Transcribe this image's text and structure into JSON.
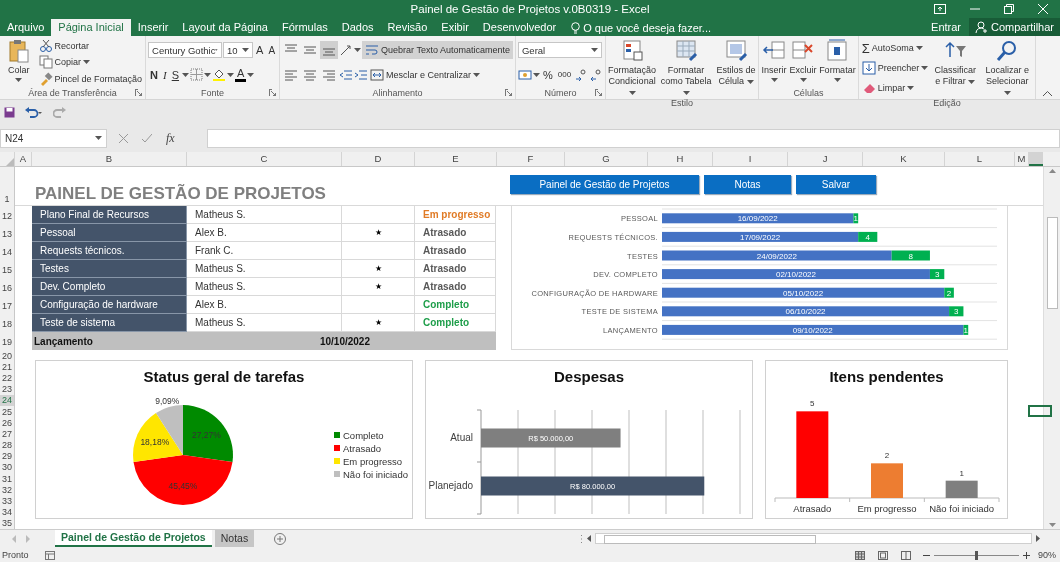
{
  "window": {
    "title": "Painel de Gestão de Projetos v.0B0319 - Excel"
  },
  "ribbon_tabs": [
    {
      "label": "Arquivo",
      "selected": false
    },
    {
      "label": "Página Inicial",
      "selected": true
    },
    {
      "label": "Inserir",
      "selected": false
    },
    {
      "label": "Layout da Página",
      "selected": false
    },
    {
      "label": "Fórmulas",
      "selected": false
    },
    {
      "label": "Dados",
      "selected": false
    },
    {
      "label": "Revisão",
      "selected": false
    },
    {
      "label": "Exibir",
      "selected": false
    },
    {
      "label": "Desenvolvedor",
      "selected": false
    }
  ],
  "tell_me": {
    "placeholder": "O que você deseja fazer..."
  },
  "account": {
    "sign_in": "Entrar",
    "share": "Compartilhar"
  },
  "ribbon": {
    "groups": [
      {
        "kind": "clipboard",
        "label": "Área de Transferência",
        "paste": "Colar",
        "cut": "Recortar",
        "copy": "Copiar",
        "painter": "Pincel de Formatação"
      },
      {
        "kind": "font",
        "label": "Fonte",
        "font": "Century Gothic",
        "size": "10",
        "grow": "A",
        "shrink": "A",
        "bold": "N",
        "italic": "I",
        "underline": "S",
        "color_letter": "A"
      },
      {
        "kind": "alignment",
        "label": "Alinhamento",
        "wrap": {
          "label": "Quebrar Texto Automaticamente",
          "on": true
        },
        "merge": "Mesclar e Centralizar",
        "bottom_align_on": true
      },
      {
        "kind": "number",
        "label": "Número",
        "format": "Geral",
        "percent": "%",
        "thousands": "000"
      },
      {
        "kind": "styles",
        "label": "Estilo",
        "buttons": [
          "Formatação Condicional",
          "Formatar como Tabela",
          "Estilos de Célula"
        ]
      },
      {
        "kind": "cells",
        "label": "Células",
        "buttons": [
          "Inserir",
          "Excluir",
          "Formatar"
        ]
      },
      {
        "kind": "editing",
        "label": "Edição",
        "sigma": "Σ",
        "autosum": "AutoSoma",
        "fill": "Preencher",
        "clear": "Limpar",
        "buttons": [
          "Classificar e Filtrar",
          "Localizar e Selecionar"
        ]
      }
    ]
  },
  "formula_bar": {
    "name_box": "N24",
    "function_label": "fx"
  },
  "columns": [
    "A",
    "B",
    "C",
    "D",
    "E",
    "F",
    "G",
    "H",
    "I",
    "J",
    "K",
    "L",
    "M"
  ],
  "row_headers": [
    {
      "label": "1",
      "selected": false
    },
    {
      "label": "12",
      "selected": false
    },
    {
      "label": "13",
      "selected": false
    },
    {
      "label": "14",
      "selected": false
    },
    {
      "label": "15",
      "selected": false
    },
    {
      "label": "16",
      "selected": false
    },
    {
      "label": "17",
      "selected": false
    },
    {
      "label": "18",
      "selected": false
    },
    {
      "label": "19",
      "selected": false
    },
    {
      "label": "20",
      "selected": false
    },
    {
      "label": "21",
      "selected": false
    },
    {
      "label": "22",
      "selected": false
    },
    {
      "label": "23",
      "selected": false
    },
    {
      "label": "24",
      "selected": true
    },
    {
      "label": "25",
      "selected": false
    },
    {
      "label": "26",
      "selected": false
    },
    {
      "label": "27",
      "selected": false
    },
    {
      "label": "28",
      "selected": false
    },
    {
      "label": "29",
      "selected": false
    },
    {
      "label": "30",
      "selected": false
    },
    {
      "label": "31",
      "selected": false
    },
    {
      "label": "32",
      "selected": false
    },
    {
      "label": "33",
      "selected": false
    },
    {
      "label": "34",
      "selected": false
    },
    {
      "label": "35",
      "selected": false
    }
  ],
  "sheet": {
    "title": "PAINEL DE GESTÃO DE PROJETOS",
    "buttons": [
      "Painel de Gestão de Projetos",
      "Notas",
      "Salvar"
    ],
    "tasks": [
      {
        "task": "Plano Final de Recursos",
        "owner": "Matheus S.",
        "status": "Em progresso",
        "color": "#e07b26"
      },
      {
        "task": "Pessoal",
        "owner": "Alex B.",
        "flag": "★",
        "status": "Atrasado",
        "color": "#595959"
      },
      {
        "task": "Requests técnicos.",
        "owner": "Frank C.",
        "status": "Atrasado",
        "color": "#595959"
      },
      {
        "task": "Testes",
        "owner": "Matheus S.",
        "flag": "★",
        "status": "Atrasado",
        "color": "#595959"
      },
      {
        "task": "Dev. Completo",
        "owner": "Matheus S.",
        "flag": "★",
        "status": "Atrasado",
        "color": "#595959"
      },
      {
        "task": "Configuração de hardware",
        "owner": "Alex B.",
        "status": "Completo",
        "color": "#1e9e4a"
      },
      {
        "task": "Teste de sistema",
        "owner": "Matheus S.",
        "flag": "★",
        "status": "Completo",
        "color": "#1e9e4a"
      }
    ],
    "launch": {
      "label": "Lançamento",
      "date": "10/10/2022"
    },
    "timeline": {
      "chart_data": {
        "type": "bar",
        "orientation": "horizontal",
        "stacked": true,
        "categories": [
          "PESSOAL",
          "REQUESTS TÉCNICOS.",
          "TESTES",
          "DEV. COMPLETO",
          "CONFIGURAÇÃO DE HARDWARE",
          "TESTE DE SISTEMA",
          "LANÇAMENTO"
        ],
        "series": [
          {
            "color": "#4472c4",
            "values": [
              40,
              41,
              48,
              56,
              59,
              60,
              63
            ],
            "value_labels": [
              "16/09/2022",
              "17/09/2022",
              "24/09/2022",
              "02/10/2022",
              "05/10/2022",
              "06/10/2022",
              "09/10/2022"
            ]
          },
          {
            "color": "#00b050",
            "values": [
              1,
              4,
              8,
              3,
              2,
              3,
              1
            ],
            "value_labels": [
              "1",
              "4",
              "8",
              "3",
              "2",
              "3",
              "1"
            ]
          }
        ]
      }
    },
    "charts": [
      {
        "chart_data": {
          "type": "pie",
          "title": "Status geral de tarefas",
          "categories": [
            "Completo",
            "Atrasado",
            "Em progresso",
            "Não foi iniciado"
          ],
          "values": [
            27.27,
            45.45,
            18.18,
            9.09
          ],
          "colors": [
            "#008a00",
            "#ff0000",
            "#ffe600",
            "#bfbfbf"
          ],
          "value_labels": [
            "27,27%",
            "45,45%",
            "18,18%",
            "9,09%"
          ]
        }
      },
      {
        "chart_data": {
          "type": "bar",
          "orientation": "horizontal",
          "stacked": true,
          "title": "Despesas",
          "categories": [
            "Atual",
            "Planejado"
          ],
          "series": [
            {
              "color": "#7f7f7f",
              "values": [
                50000,
                null
              ],
              "value_labels": [
                "R$ 50.000,00",
                null
              ]
            },
            {
              "color": "#44546a",
              "values": [
                null,
                80000
              ],
              "value_labels": [
                null,
                "R$ 80.000,00"
              ]
            }
          ]
        }
      },
      {
        "chart_data": {
          "type": "bar",
          "orientation": "vertical",
          "stacked": true,
          "title": "Itens pendentes",
          "categories": [
            "Atrasado",
            "Em progresso",
            "Não foi iniciado"
          ],
          "series": [
            {
              "color": "#ff0000",
              "values": [
                5,
                null,
                null
              ]
            },
            {
              "color": "#ed7d31",
              "values": [
                null,
                2,
                null
              ]
            },
            {
              "color": "#7f7f7f",
              "values": [
                null,
                null,
                1
              ]
            }
          ],
          "data_labels": true
        }
      }
    ]
  },
  "sheet_tabs": [
    {
      "label": "Painel de Gestão de Projetos",
      "selected": true
    },
    {
      "label": "Notas",
      "selected": false
    }
  ],
  "status_bar": {
    "status": "Pronto",
    "zoom": "90%",
    "zoom_slider": {
      "level": 0.48
    }
  }
}
